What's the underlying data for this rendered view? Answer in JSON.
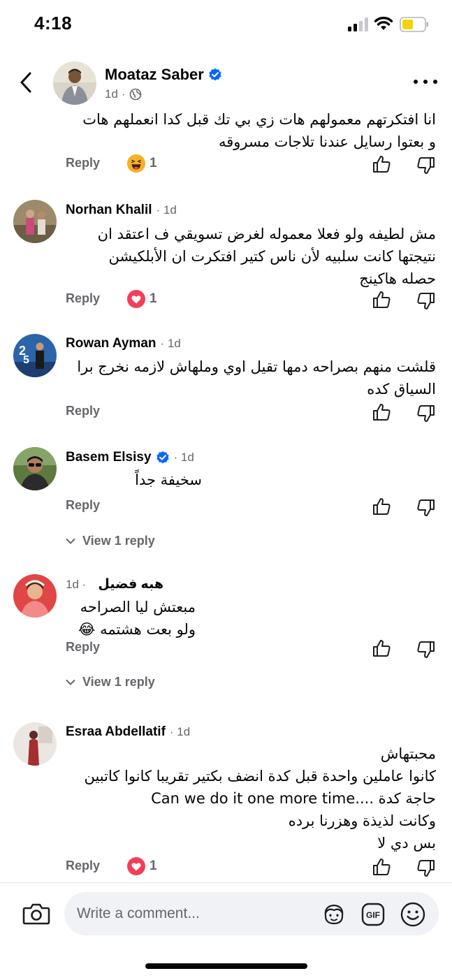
{
  "status_bar": {
    "time": "4:18"
  },
  "header": {
    "name": "Moataz Saber",
    "time": "1d",
    "separator": "·"
  },
  "comments": [
    {
      "name": "",
      "time": "",
      "text_lines": [
        "انا افتكرتهم معمولهم هات زي بي تك قبل كدا انعملهم هات",
        "و بعتوا رسايل عندنا تلاجات مسروقه"
      ],
      "reply_label": "Reply",
      "reaction": {
        "type": "haha",
        "count": "1"
      }
    },
    {
      "name": "Norhan Khalil",
      "time": "1d",
      "text_lines": [
        "مش لطيفه ولو فعلا معموله لغرض تسويقي ف اعتقد ان",
        "نتيجتها كانت  سلبيه لأن ناس كتير افتكرت ان الأبلكيشن",
        "حصله هاكينج"
      ],
      "reply_label": "Reply",
      "reaction": {
        "type": "love",
        "count": "1"
      }
    },
    {
      "name": "Rowan Ayman",
      "time": "1d",
      "text_lines": [
        "قلشت منهم بصراحه دمها تقيل اوي وملهاش لازمه نخرج برا",
        "السياق كده"
      ],
      "reply_label": "Reply"
    },
    {
      "name": "Basem Elsisy",
      "time": "1d",
      "verified": true,
      "text_lines": [
        "سخيفة جداً"
      ],
      "reply_label": "Reply",
      "view_replies": "View 1 reply"
    },
    {
      "name": "هبه  فضيل",
      "time": "1d",
      "text_lines": [
        "مبعتش ليا الصراحه",
        "ولو بعت هشتمه 😂"
      ],
      "reply_label": "Reply",
      "view_replies": "View 1 reply"
    },
    {
      "name": "Esraa Abdellatif",
      "time": "1d",
      "text_lines": [
        "محبتهاش",
        "كانوا عاملين واحدة قبل كدة انضف بكتير تقريبا كانوا كاتبين",
        "Can we do it one more time.... حاجة كدة",
        "وكانت لذيذة وهزرنا برده",
        "بس دي لا"
      ],
      "reply_label": "Reply",
      "reaction": {
        "type": "love",
        "count": "1"
      }
    }
  ],
  "composer": {
    "placeholder": "Write a comment..."
  },
  "colors": {
    "verified": "#0866ff",
    "love": "#f33e58",
    "haha": "#f7b125",
    "muted": "#65676b"
  }
}
